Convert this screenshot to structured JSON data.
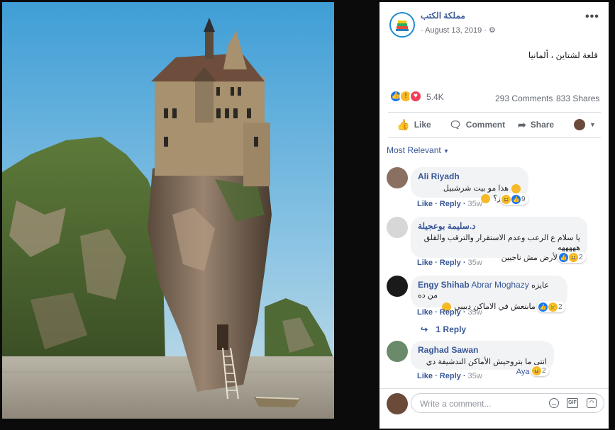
{
  "post": {
    "page_name": "مملكة الكتب",
    "date": "· August 13, 2019 ·",
    "text": "قلعة لشتاين ، ألمانيا",
    "reaction_count": "5.4K",
    "comments_count": "293 Comments",
    "shares_count": "833 Shares",
    "more_label": "•••"
  },
  "actions": {
    "like": "Like",
    "comment": "Comment",
    "share": "Share"
  },
  "sort_label": "Most Relevant",
  "comments": [
    {
      "author": "Ali Riyadh",
      "text": "هذا مو بيت شرشبيل وهرهور؟",
      "react_count": "9",
      "like": "Like",
      "reply": "Reply",
      "time": "35w"
    },
    {
      "author": "د.سليمة بوعجيلة",
      "text_line1": "يا سلام ع الرعب وعدم الاستقرار والترقب والقلق هههههه",
      "text_line2": "احنا ع الأرض مش ناجيين",
      "react_count": "2",
      "like": "Like",
      "reply": "Reply",
      "time": "35w"
    },
    {
      "author": "Engy Shihab",
      "tag": "Abrar Moghazy",
      "text_line1": "عايزه من ده",
      "text_line2": "احنا ليه مابنعش في الاماكن ديييي",
      "react_count": "2",
      "like": "Like",
      "reply": "Reply",
      "time": "35w"
    },
    {
      "author": "Raghad Sawan",
      "text_line1": "انتي ما بتروحيش الأماكن الندشيفة دي ليه ؟",
      "tag": "Aya",
      "react_count": "2",
      "like": "Like",
      "reply": "Reply",
      "time": "35w"
    }
  ],
  "reply_link": "1 Reply",
  "write_comment": {
    "placeholder": "Write a comment..."
  },
  "icons": {
    "emoji": "smile-icon",
    "gif": "GIF",
    "sticker": "sticker-icon"
  },
  "colors": {
    "link": "#385898",
    "like_blue": "#1877f2",
    "love_red": "#f33e58",
    "wow_yellow": "#f7b928"
  }
}
